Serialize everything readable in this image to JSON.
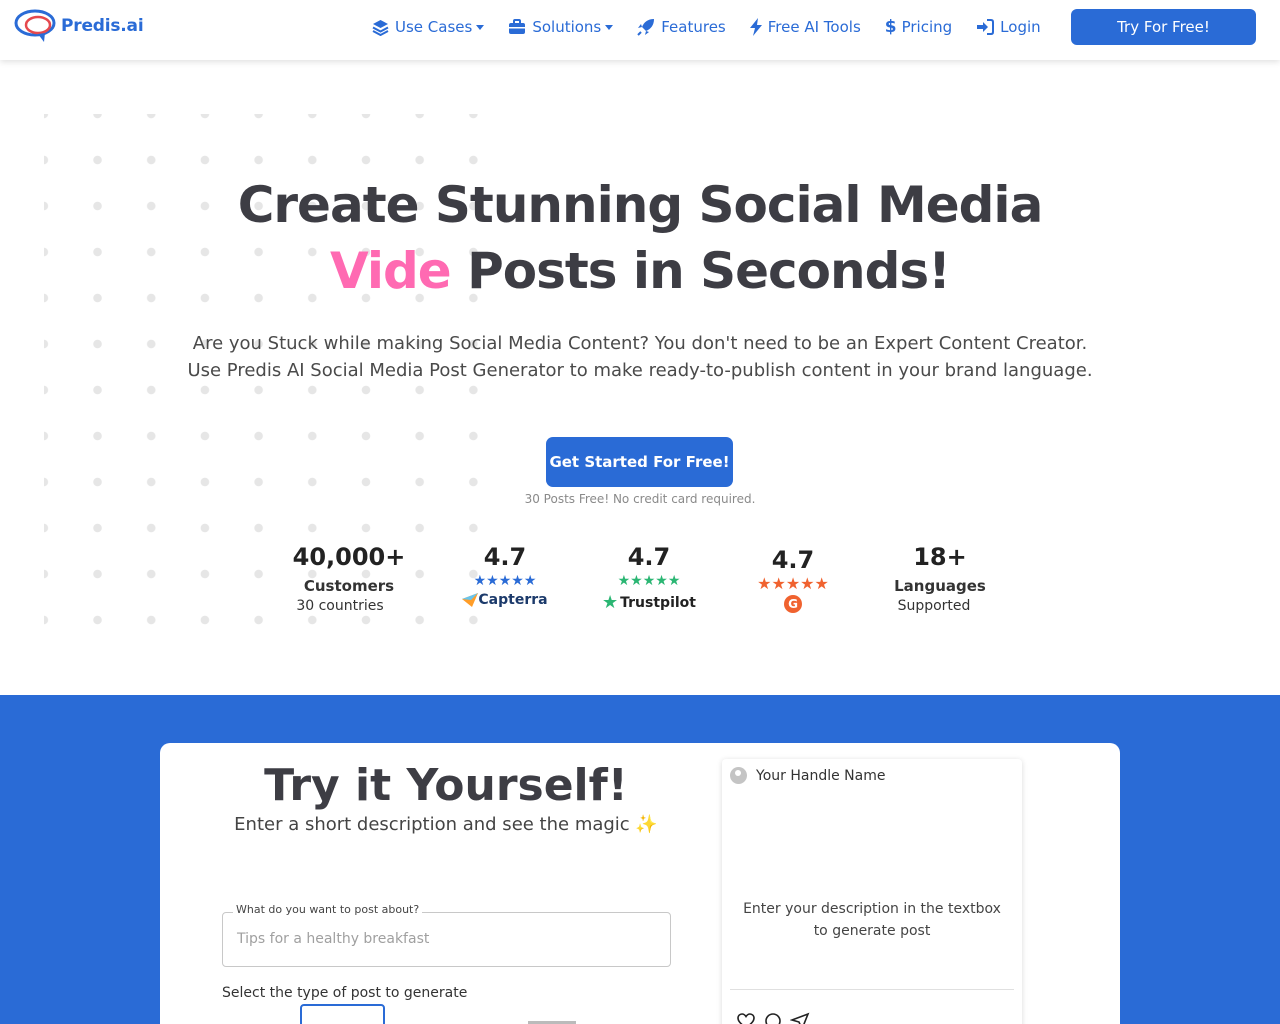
{
  "brand": {
    "name": "Predis.ai"
  },
  "nav": {
    "items": [
      {
        "label": "Use Cases",
        "icon": "layers-icon",
        "dropdown": true
      },
      {
        "label": "Solutions",
        "icon": "briefcase-icon",
        "dropdown": true
      },
      {
        "label": "Features",
        "icon": "rocket-icon",
        "dropdown": false
      },
      {
        "label": "Free AI Tools",
        "icon": "bolt-icon",
        "dropdown": false
      },
      {
        "label": "Pricing",
        "icon": "dollar-icon",
        "dropdown": false
      },
      {
        "label": "Login",
        "icon": "login-icon",
        "dropdown": false
      }
    ],
    "cta": "Try For Free!"
  },
  "hero": {
    "title_line1": "Create Stunning Social Media",
    "title_highlight": "Vide",
    "title_line2_rest": " Posts in Seconds!",
    "subtitle_line1": "Are you Stuck while making Social Media Content? You don't need to be an Expert Content Creator.",
    "subtitle_line2": "Use Predis AI Social Media Post Generator to make ready-to-publish content in your brand language.",
    "cta": "Get Started For Free!",
    "note": "30 Posts Free! No credit card required."
  },
  "stats": {
    "customers": {
      "value": "40,000+",
      "label": "Customers",
      "sub": "30 countries"
    },
    "capterra": {
      "value": "4.7",
      "stars": "★★★★★",
      "brand": "Capterra"
    },
    "trustpilot": {
      "value": "4.7",
      "stars": "★★★★★",
      "brand": "Trustpilot"
    },
    "g2": {
      "value": "4.7",
      "stars": "★★★★★",
      "brand": "G"
    },
    "languages": {
      "value": "18+",
      "label": "Languages",
      "sub": "Supported"
    }
  },
  "try": {
    "title": "Try it Yourself!",
    "subtitle": "Enter a short description and see the magic ✨",
    "field_label": "What do you want to post about?",
    "field_placeholder": "Tips for a healthy breakfast",
    "type_label": "Select the type of post to generate"
  },
  "preview": {
    "handle": "Your Handle Name",
    "placeholder_line1": "Enter your description in the textbox",
    "placeholder_line2": "to generate post"
  },
  "colors": {
    "accent": "#2a6bd6",
    "highlight": "#ff6ab2",
    "capterra": "#2a6bd6",
    "trustpilot": "#2bb673",
    "g2": "#f0622f"
  }
}
